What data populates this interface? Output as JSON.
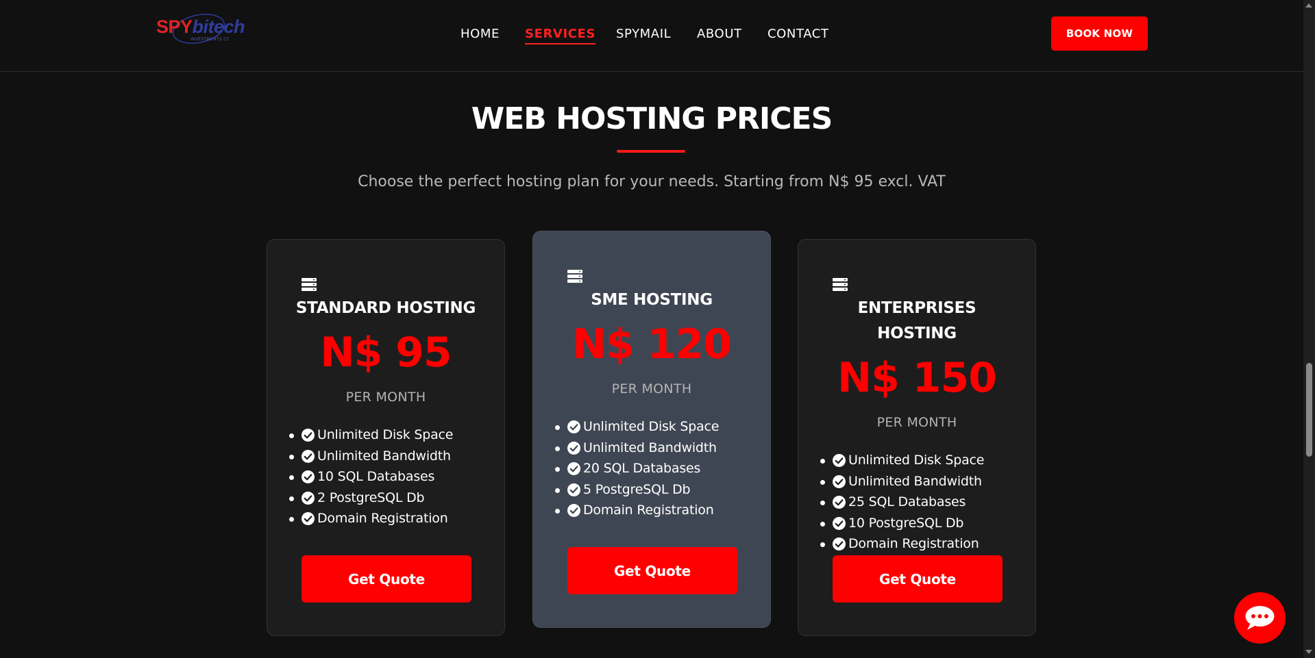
{
  "brand": {
    "logo_part1": "SPY",
    "logo_part2": "bitech",
    "logo_tagline": "INVESTMENTS CC",
    "accent_color": "#ff0000",
    "secondary_color": "#2f3c9e"
  },
  "nav": {
    "items": [
      {
        "label": "HOME",
        "active": false
      },
      {
        "label": "SERVICES",
        "active": true
      },
      {
        "label": "SPYMAIL",
        "active": false
      },
      {
        "label": "ABOUT",
        "active": false
      },
      {
        "label": "CONTACT",
        "active": false
      }
    ],
    "book_label": "BOOK NOW"
  },
  "section": {
    "title": "WEB HOSTING PRICES",
    "subtitle": "Choose the perfect hosting plan for your needs. Starting from N$ 95 excl. VAT"
  },
  "plans": [
    {
      "icon": "server-icon",
      "name": "STANDARD HOSTING",
      "price": "N$ 95",
      "period": "PER MONTH",
      "features": [
        "Unlimited Disk Space",
        "Unlimited Bandwidth",
        "10 SQL Databases",
        "2 PostgreSQL Db",
        "Domain Registration"
      ],
      "button": "Get Quote",
      "featured": false
    },
    {
      "icon": "server-icon",
      "name": "SME HOSTING",
      "price": "N$ 120",
      "period": "PER MONTH",
      "features": [
        "Unlimited Disk Space",
        "Unlimited Bandwidth",
        "20 SQL Databases",
        "5 PostgreSQL Db",
        "Domain Registration"
      ],
      "button": "Get Quote",
      "featured": true
    },
    {
      "icon": "server-icon",
      "name_line1": "ENTERPRISES",
      "name_line2": "HOSTING",
      "price": "N$ 150",
      "period": "PER MONTH",
      "features": [
        "Unlimited Disk Space",
        "Unlimited Bandwidth",
        "25 SQL Databases",
        "10 PostgreSQL Db",
        "Domain Registration"
      ],
      "button": "Get Quote",
      "featured": false
    }
  ],
  "chat": {
    "icon": "chat-bubble-icon"
  }
}
